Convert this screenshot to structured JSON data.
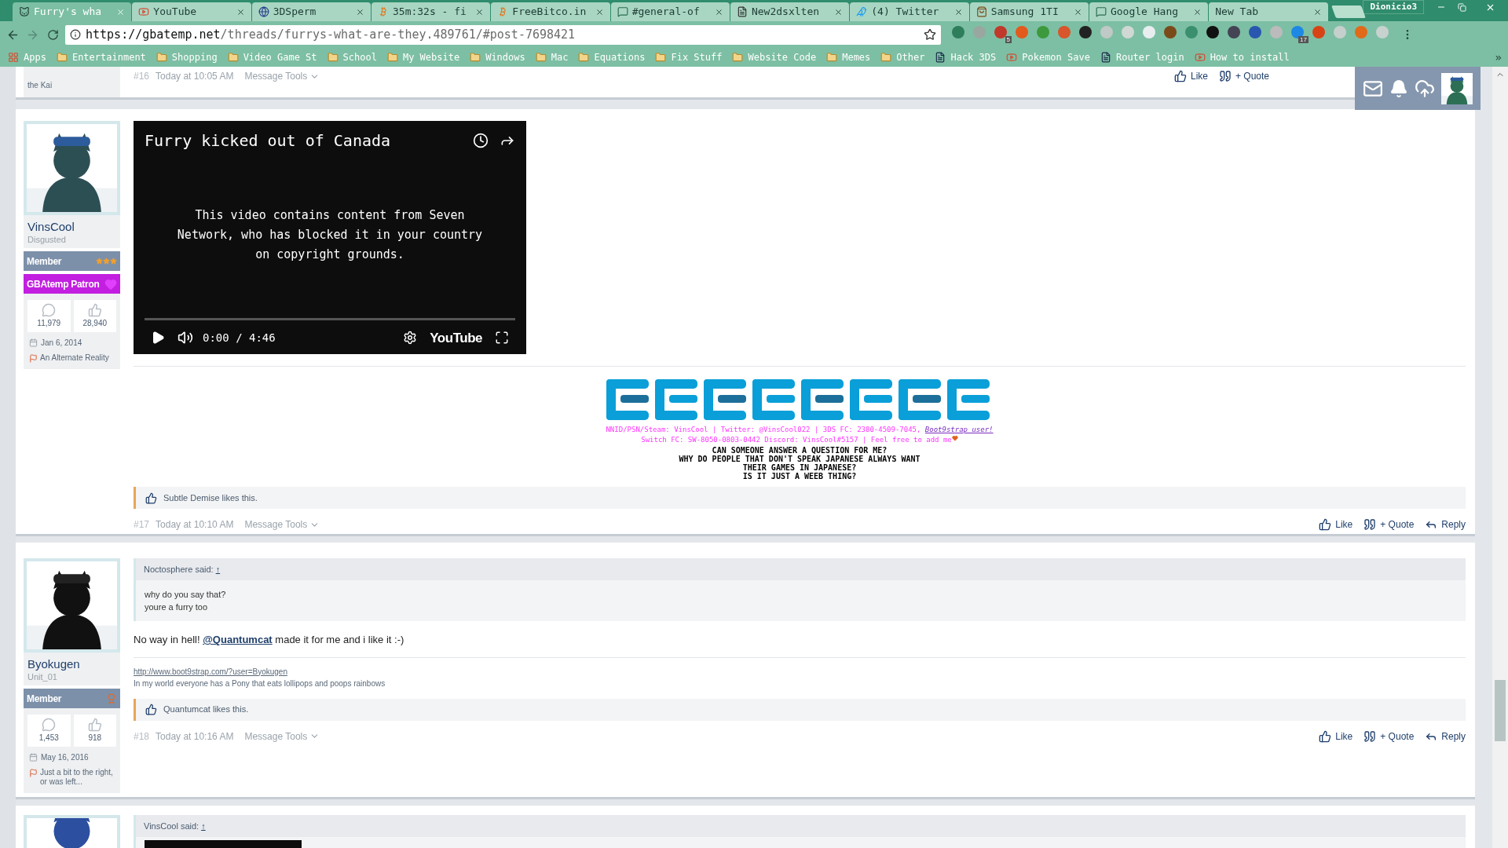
{
  "browser": {
    "tabs": [
      {
        "title": "Furry's wha",
        "kind": "cat",
        "selected": true
      },
      {
        "title": "YouTube",
        "kind": "youtube",
        "selected": false
      },
      {
        "title": "3DSperm",
        "kind": "globe",
        "selected": false
      },
      {
        "title": "35m:32s - fi",
        "kind": "bitcoin",
        "selected": false
      },
      {
        "title": "FreeBitco.in",
        "kind": "bitcoin",
        "selected": false
      },
      {
        "title": "#general-of",
        "kind": "chat",
        "selected": false
      },
      {
        "title": "New2dsxlten",
        "kind": "page",
        "selected": false
      },
      {
        "title": "(4) Twitter",
        "kind": "bird",
        "selected": false
      },
      {
        "title": "Samsung 1TI",
        "kind": "bag",
        "selected": false
      },
      {
        "title": "Google Hang",
        "kind": "chat",
        "selected": false
      },
      {
        "title": "New Tab",
        "selected": false
      }
    ],
    "profile": "Dionicio3",
    "url_host": "https://gbatemp.net",
    "url_path": "/threads/furrys-what-are-they.489761/#post-7698421",
    "extensions": [
      {
        "kind": "plain"
      },
      {
        "kind": "plain"
      },
      {
        "kind": "badged",
        "badge": "5"
      },
      {
        "kind": "plain"
      },
      {
        "kind": "plain"
      },
      {
        "kind": "plain"
      },
      {
        "kind": "plain"
      },
      {
        "kind": "plain"
      },
      {
        "kind": "plain"
      },
      {
        "kind": "plain"
      },
      {
        "kind": "plain"
      },
      {
        "kind": "plain"
      },
      {
        "kind": "plain"
      },
      {
        "kind": "plain"
      },
      {
        "kind": "plain"
      },
      {
        "kind": "plain"
      },
      {
        "kind": "badged",
        "badge": "17"
      },
      {
        "kind": "plain"
      },
      {
        "kind": "plain"
      },
      {
        "kind": "plain"
      },
      {
        "kind": "plain"
      }
    ],
    "bookmarks": [
      {
        "label": "Apps",
        "kind": "apps"
      },
      {
        "label": "Entertainment",
        "kind": "folder"
      },
      {
        "label": "Shopping",
        "kind": "folder"
      },
      {
        "label": "Video Game St",
        "kind": "folder"
      },
      {
        "label": "School",
        "kind": "folder"
      },
      {
        "label": "My Website",
        "kind": "folder"
      },
      {
        "label": "Windows",
        "kind": "folder"
      },
      {
        "label": "Mac",
        "kind": "folder"
      },
      {
        "label": "Equations",
        "kind": "folder"
      },
      {
        "label": "Fix Stuff",
        "kind": "folder"
      },
      {
        "label": "Website Code",
        "kind": "folder"
      },
      {
        "label": "Memes",
        "kind": "folder"
      },
      {
        "label": "Other",
        "kind": "folder"
      },
      {
        "label": "Hack 3DS",
        "kind": "page"
      },
      {
        "label": "Pokemon Save",
        "kind": "video"
      },
      {
        "label": "Router login",
        "kind": "page"
      },
      {
        "label": "How to install",
        "kind": "video"
      }
    ],
    "overflow": "»"
  },
  "post_16": {
    "user_tail": "the Kai",
    "footer": {
      "number": "#16",
      "time": "Today at 10:05 AM",
      "tools": "Message Tools",
      "actions": [
        "Like",
        "+ Quote"
      ]
    }
  },
  "post_17": {
    "user": {
      "name": "VinsCool",
      "title": "Disgusted",
      "banners": [
        {
          "label": "Member",
          "kind": "member"
        },
        {
          "label": "GBAtemp Patron",
          "kind": "patron"
        }
      ],
      "messages": "11,979",
      "likes": "28,940",
      "joined": "Jan 6, 2014",
      "location": "An Alternate Reality"
    },
    "video": {
      "title": "Furry kicked out of Canada",
      "message": "This video contains content from Seven Network, who has blocked it in your country on copyright grounds.",
      "time": "0:00 / 4:46",
      "brand": "YouTube"
    },
    "signature": {
      "line_1": "NNID/PSN/Steam: VinsCool | Twitter: @VinsCool022 | 3DS FC: 2380-4509-7045,",
      "link": "Boot9strap user!",
      "line_2": "Switch FC: SW-8050-0803-0442 Discord: VinsCool#5157 | Feel free to add me",
      "questions": [
        "CAN SOMEONE ANSWER A QUESTION FOR ME?",
        "WHY DO PEOPLE THAT DON'T SPEAK JAPANESE ALWAYS WANT",
        "THEIR GAMES IN JAPANESE?",
        "IS IT JUST A WEEB THING?"
      ]
    },
    "likes": "Subtle Demise likes this.",
    "footer": {
      "number": "#17",
      "time": "Today at 10:10 AM",
      "tools": "Message Tools",
      "actions": [
        "Like",
        "+ Quote",
        "Reply"
      ]
    }
  },
  "post_18": {
    "user": {
      "name": "Byokugen",
      "title": "Unit_01",
      "banners": [
        {
          "label": "Member",
          "kind": "medal"
        }
      ],
      "messages": "1,453",
      "likes": "918",
      "joined": "May 16, 2016",
      "location": "Just a bit to the right, or was left..."
    },
    "quote": {
      "author": "Noctosphere said:",
      "jump": "↑",
      "lines": [
        "why do you say that?",
        "youre a furry too"
      ]
    },
    "message": {
      "before": "No way in hell!",
      "mention": "@Quantumcat",
      "after": "made it for me and i like it :-)"
    },
    "signature": {
      "link": "http://www.boot9strap.com/?user=Byokugen",
      "text": "In my world everyone has a Pony that eats lollipops and poops rainbows"
    },
    "likes": "Quantumcat likes this.",
    "footer": {
      "number": "#18",
      "time": "Today at 10:16 AM",
      "tools": "Message Tools",
      "actions": [
        "Like",
        "+ Quote",
        "Reply"
      ]
    }
  },
  "post_19": {
    "quote": {
      "author": "VinsCool said:",
      "jump": "↑"
    }
  }
}
